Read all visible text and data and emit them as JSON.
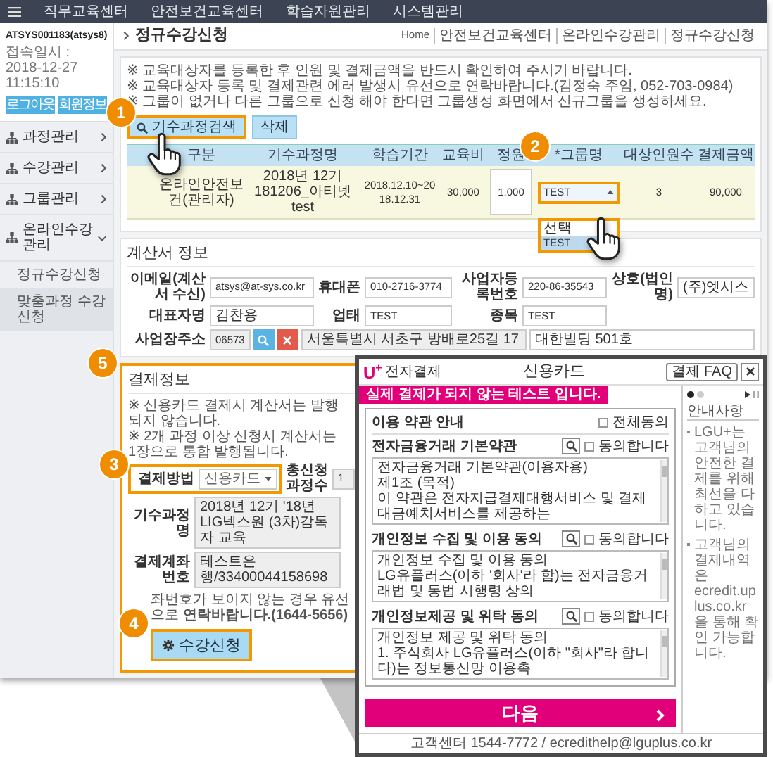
{
  "top_nav": {
    "items": [
      "직무교육센터",
      "안전보건교육센터",
      "학습자원관리",
      "시스템관리"
    ]
  },
  "sidebar": {
    "user": "ATSYS001183(atsys8)",
    "login_time": "접속일시 : 2018-12-27 11:15:10",
    "buttons": [
      "로그아웃",
      "회원정보"
    ],
    "items": [
      {
        "label": "과정관리",
        "expanded": false
      },
      {
        "label": "수강관리",
        "expanded": false
      },
      {
        "label": "그룹관리",
        "expanded": false
      },
      {
        "label": "온라인수강관리",
        "expanded": true,
        "children": [
          {
            "label": "정규수강신청",
            "selected": false
          },
          {
            "label": "맞춤과정 수강신청",
            "selected": true
          }
        ]
      }
    ]
  },
  "page": {
    "title": "정규수강신청",
    "breadcrumb": [
      "Home",
      "안전보건교육센터",
      "온라인수강관리",
      "정규수강신청"
    ],
    "notes": [
      "※ 교육대상자를 등록한 후 인원 및 결제금액을 반드시 확인하여 주시기 바랍니다.",
      "※ 교육대상자 등록 및 결제관련 에러 발생시 유선으로 연락바랍니다.(김정숙 주임, 052-703-0984)",
      "※ 그룹이 없거나 다른 그룹으로 신청 해야 한다면 그룹생성 화면에서 신규그룹을 생성하세요."
    ],
    "buttons": [
      {
        "label": "기수과정검색",
        "kind": "search"
      },
      {
        "label": "삭제",
        "kind": "delete"
      }
    ]
  },
  "course_table": {
    "columns": [
      "구분",
      "기수과정명",
      "학습기간",
      "교육비",
      "정원",
      "*그룹명",
      "대상인원수",
      "결제금액"
    ],
    "rows": [
      {
        "cells": [
          {
            "kind": "text",
            "text": "온라인안전보건(관리자)"
          },
          {
            "kind": "text",
            "text": "2018년 12기 181206_아티넷test"
          },
          {
            "kind": "text",
            "text": "2018.12.10~2018.12.31"
          },
          {
            "kind": "text",
            "text": "30,000"
          },
          {
            "kind": "input",
            "text": "1,000"
          },
          {
            "kind": "select",
            "value": "TEST",
            "expanded": true,
            "options": [
              {
                "label": "선택",
                "selected": false
              },
              {
                "label": "TEST",
                "selected": true
              }
            ]
          },
          {
            "kind": "text",
            "text": "3"
          },
          {
            "kind": "text",
            "text": "90,000"
          }
        ]
      }
    ]
  },
  "invoice": {
    "title": "계산서 정보",
    "fields": [
      {
        "label": "이메일(계산서 수신)",
        "value": "atsys@at-sys.co.kr"
      },
      {
        "label": "휴대폰",
        "value": "010-2716-3774"
      },
      {
        "label": "사업자등록번호",
        "value": "220-86-35543"
      },
      {
        "label": "상호(법인명)",
        "value": "(주)엣시스"
      },
      {
        "label": "대표자명",
        "value": "김찬용"
      },
      {
        "label": "업태",
        "value": "TEST"
      },
      {
        "label": "종목",
        "value": "TEST"
      }
    ],
    "address": {
      "label": "사업장주소",
      "zip": "06573",
      "address1": "서울특별시 서초구 방배로25길 17",
      "address2": "대한빌딩 501호"
    }
  },
  "payment": {
    "title": "결제정보",
    "notes": [
      "※ 신용카드 결제시 계산서는 발행되지 않습니다.",
      "※ 2개 과정 이상 신청시 계산서는 1장으로 통합 발행됩니다."
    ],
    "method": {
      "label": "결제방법",
      "value": "신용카드"
    },
    "count": {
      "label": "총신청과정수",
      "value": "1"
    },
    "course": {
      "label": "기수과정명",
      "value": "2018년 12기 '18년 LIG넥스원 (3차)감독자 교육"
    },
    "account": {
      "label": "결제계좌번호",
      "value": "테스트은행/33400044158698"
    },
    "notice": "좌번호가 보이지 않는 경우 유선으로 **연락바랍니다.(1644-5656)**",
    "submit": "수강신청"
  },
  "steps": [
    "1",
    "2",
    "3",
    "4",
    "5"
  ],
  "popup": {
    "brand_mark": "U$^{+}$",
    "brand_name": "전자결제",
    "title": "신용카드",
    "faq": "결제 FAQ",
    "banner": "실제 결제가 되지 않는 테스트 입니다.",
    "terms_title": "이용 약관 안내",
    "agree_all": {
      "label": "전체동의",
      "checked": false
    },
    "sections": [
      {
        "title": "전자금융거래 기본약관",
        "agree": {
          "label": "동의합니다",
          "checked": false
        },
        "lines": [
          "전자금융거래 기본약관(이용자용)",
          "제1조 (목적)",
          "이 약관은 전자지급결제대행서비스 및 결제대금예치서비스를 제공하는"
        ]
      },
      {
        "title": "개인정보 수집 및 이용 동의",
        "agree": {
          "label": "동의합니다",
          "checked": false
        },
        "lines": [
          "개인정보 수집 및 이용 동의",
          "LG유플러스(이하 '회사'라 함)는 전자금융거래법 및 동법 시행령 상의"
        ]
      },
      {
        "title": "개인정보제공 및 위탁 동의",
        "agree": {
          "label": "동의합니다",
          "checked": false
        },
        "lines": [
          "개인정보 제공 및 위탁 동의",
          "1. 주식회사 LG유플러스(이하 \"회사\"라 합니다)는 정보통신망 이용촉"
        ]
      }
    ],
    "next": "다음",
    "carousel": [
      {
        "selected": true
      },
      {
        "selected": false
      }
    ],
    "info_title": "안내사항",
    "info": [
      "LGU+는 고객님의 안전한 결제를 위해 최선을 다하고 있습니다.",
      "고객님의 결제내역은 ecredit.uplus.co.kr을 통해 확인 가능합니다."
    ],
    "footer": "고객센터 1544-7772 / ecredithelp@lguplus.co.kr"
  }
}
